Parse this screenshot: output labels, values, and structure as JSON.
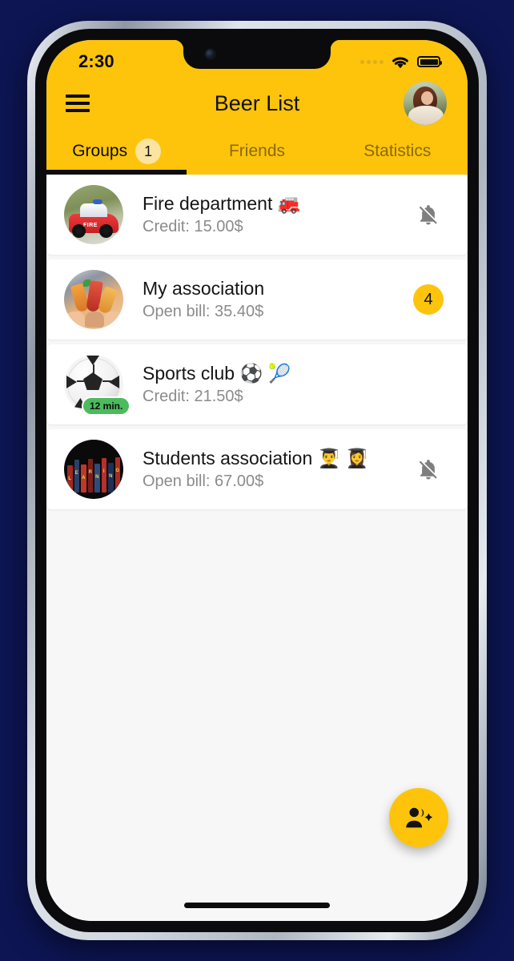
{
  "status_bar": {
    "time": "2:30",
    "signal_icon": "signal-dots-icon",
    "wifi_icon": "wifi-icon",
    "battery_icon": "battery-full-icon"
  },
  "app_bar": {
    "menu_icon": "hamburger-menu-icon",
    "title": "Beer List",
    "avatar_label": "profile-avatar"
  },
  "tabs": [
    {
      "label": "Groups",
      "badge": "1",
      "active": true
    },
    {
      "label": "Friends",
      "badge": "",
      "active": false
    },
    {
      "label": "Statistics",
      "badge": "",
      "active": false
    }
  ],
  "groups": [
    {
      "title": "Fire department 🚒",
      "subtitle": "Credit: 15.00$",
      "trailing_type": "bell-off",
      "trailing_value": "",
      "time_badge": ""
    },
    {
      "title": "My association",
      "subtitle": "Open bill: 35.40$",
      "trailing_type": "count",
      "trailing_value": "4",
      "time_badge": ""
    },
    {
      "title": "Sports club ⚽ 🎾",
      "subtitle": "Credit: 21.50$",
      "trailing_type": "none",
      "trailing_value": "",
      "time_badge": "12 min."
    },
    {
      "title": "Students association 👨‍🎓 👩‍🎓",
      "subtitle": "Open bill: 67.00$",
      "trailing_type": "bell-off",
      "trailing_value": "",
      "time_badge": ""
    }
  ],
  "fab": {
    "icon": "person-add-icon",
    "label": "Add group"
  },
  "colors": {
    "brand_yellow": "#fdc40b",
    "badge_soft_yellow": "#fbe3a0",
    "green_badge": "#4cbb5e",
    "page_background": "#0d1553",
    "list_background": "#f7f7f7",
    "card_background": "#ffffff",
    "muted_text": "#8b8b8b",
    "tab_inactive_text": "#8a6a08"
  },
  "books_colors": [
    "#9e2a22",
    "#2b3f6b",
    "#c1372c",
    "#7e1f1a",
    "#324a79",
    "#b5312a",
    "#1f2f57",
    "#a82c24"
  ],
  "books_letters": [
    "L",
    "E",
    "A",
    "R",
    "N",
    "I",
    "N",
    "G"
  ]
}
